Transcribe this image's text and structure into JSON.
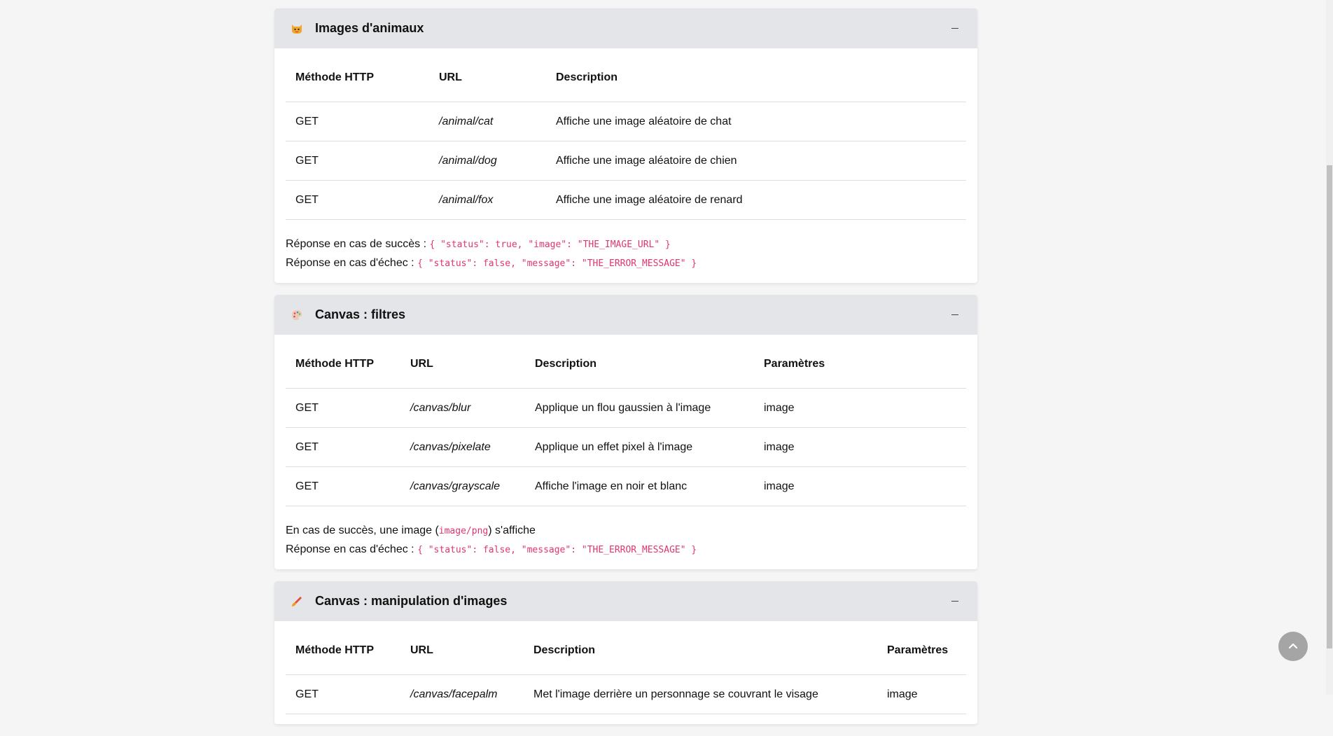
{
  "sections": [
    {
      "icon": "cat-face-icon",
      "title": "Images d'animaux",
      "headers": [
        "Méthode HTTP",
        "URL",
        "Description"
      ],
      "rows": [
        [
          "GET",
          "/animal/cat",
          "Affiche une image aléatoire de chat"
        ],
        [
          "GET",
          "/animal/dog",
          "Affiche une image aléatoire de chien"
        ],
        [
          "GET",
          "/animal/fox",
          "Affiche une image aléatoire de renard"
        ]
      ],
      "notes": [
        {
          "text": "Réponse en cas de succès : ",
          "code": "{ \"status\": true, \"image\": \"THE_IMAGE_URL\" }",
          "after": ""
        },
        {
          "text": "Réponse en cas d'échec : ",
          "code": "{ \"status\": false, \"message\": \"THE_ERROR_MESSAGE\" }",
          "after": ""
        }
      ]
    },
    {
      "icon": "palette-icon",
      "title": "Canvas : filtres",
      "headers": [
        "Méthode HTTP",
        "URL",
        "Description",
        "Paramètres"
      ],
      "rows": [
        [
          "GET",
          "/canvas/blur",
          "Applique un flou gaussien à l'image",
          "image"
        ],
        [
          "GET",
          "/canvas/pixelate",
          "Applique un effet pixel à l'image",
          "image"
        ],
        [
          "GET",
          "/canvas/grayscale",
          "Affiche l'image en noir et blanc",
          "image"
        ]
      ],
      "notes": [
        {
          "text": "En cas de succès, une image (",
          "code": "image/png",
          "after": ") s'affiche"
        },
        {
          "text": "Réponse en cas d'échec : ",
          "code": "{ \"status\": false, \"message\": \"THE_ERROR_MESSAGE\" }",
          "after": ""
        }
      ]
    },
    {
      "icon": "paintbrush-icon",
      "title": "Canvas : manipulation d'images",
      "headers": [
        "Méthode HTTP",
        "URL",
        "Description",
        "Paramètres"
      ],
      "rows": [
        [
          "GET",
          "/canvas/facepalm",
          "Met l'image derrière un personnage se couvrant le visage",
          "image"
        ]
      ],
      "notes": []
    }
  ],
  "colors": {
    "header_bg": "#e4e5e8",
    "code": "#e0356e",
    "page_bg": "#f5f5f5"
  },
  "scroll_top_icon": "chevron-up-icon"
}
